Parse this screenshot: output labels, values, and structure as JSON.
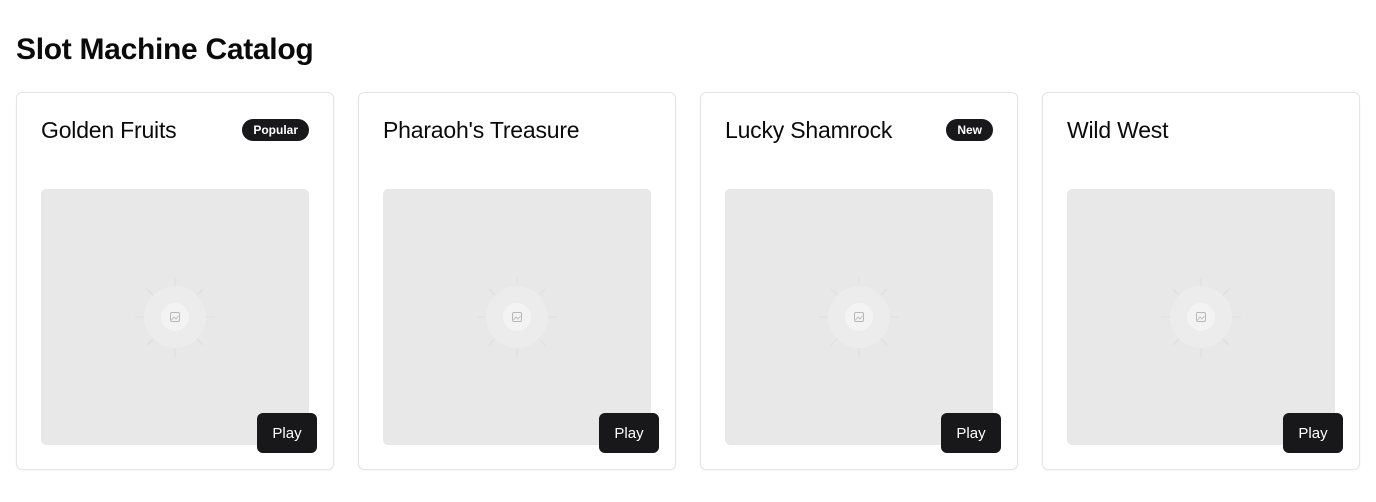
{
  "page": {
    "title": "Slot Machine Catalog"
  },
  "colors": {
    "button_bg": "#18181b",
    "badge_bg": "#18181b",
    "placeholder_bg": "#e8e8e8",
    "card_border": "#e4e4e7"
  },
  "cards": [
    {
      "title": "Golden Fruits",
      "badge": "Popular",
      "image_icon": "image-placeholder-icon",
      "play_label": "Play"
    },
    {
      "title": "Pharaoh's Treasure",
      "badge": "",
      "image_icon": "image-placeholder-icon",
      "play_label": "Play"
    },
    {
      "title": "Lucky Shamrock",
      "badge": "New",
      "image_icon": "image-placeholder-icon",
      "play_label": "Play"
    },
    {
      "title": "Wild West",
      "badge": "",
      "image_icon": "image-placeholder-icon",
      "play_label": "Play"
    }
  ]
}
